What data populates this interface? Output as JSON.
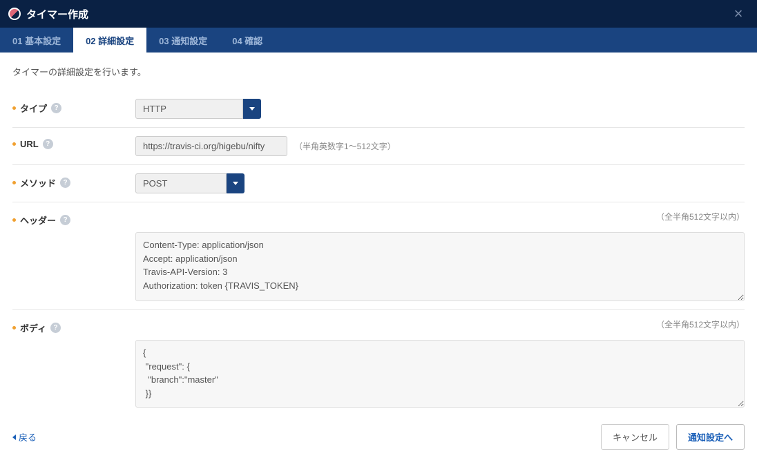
{
  "header": {
    "title": "タイマー作成"
  },
  "tabs": [
    {
      "label": "01 基本設定"
    },
    {
      "label": "02 詳細設定"
    },
    {
      "label": "03 通知設定"
    },
    {
      "label": "04 確認"
    }
  ],
  "description": "タイマーの詳細設定を行います。",
  "form": {
    "type": {
      "label": "タイプ",
      "value": "HTTP"
    },
    "url": {
      "label": "URL",
      "value": "https://travis-ci.org/higebu/nifty",
      "hint": "（半角英数字1～512文字）"
    },
    "method": {
      "label": "メソッド",
      "value": "POST"
    },
    "headers": {
      "label": "ヘッダー",
      "hint": "（全半角512文字以内）",
      "value": "Content-Type: application/json\nAccept: application/json\nTravis-API-Version: 3\nAuthorization: token {TRAVIS_TOKEN}"
    },
    "body": {
      "label": "ボディ",
      "hint": "（全半角512文字以内）",
      "value": "{\n \"request\": {\n  \"branch\":\"master\"\n }}"
    }
  },
  "footer": {
    "back": "戻る",
    "cancel": "キャンセル",
    "next": "通知設定へ"
  }
}
